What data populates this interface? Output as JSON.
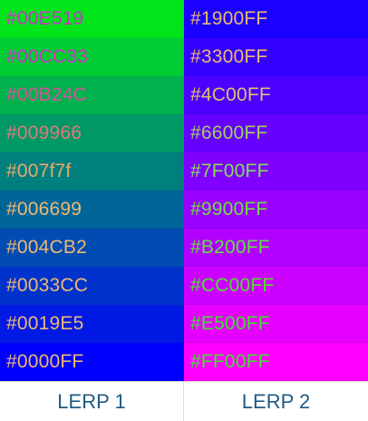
{
  "columns": [
    {
      "label": "LERP 1",
      "cells": [
        {
          "text": "#00E519",
          "bg": "#00E519",
          "fg": "#CC33CC"
        },
        {
          "text": "#00CC33",
          "bg": "#00CC33",
          "fg": "#CC33CC"
        },
        {
          "text": "#00B24C",
          "bg": "#00B24C",
          "fg": "#D84F9E"
        },
        {
          "text": "#009966",
          "bg": "#009966",
          "fg": "#E07880"
        },
        {
          "text": "#007f7f",
          "bg": "#007F7F",
          "fg": "#E9A968"
        },
        {
          "text": "#006699",
          "bg": "#006699",
          "fg": "#F0B870"
        },
        {
          "text": "#004CB2",
          "bg": "#004CB2",
          "fg": "#F0B870"
        },
        {
          "text": "#0033CC",
          "bg": "#0033CC",
          "fg": "#F0B870"
        },
        {
          "text": "#0019E5",
          "bg": "#0019E5",
          "fg": "#F0B870"
        },
        {
          "text": "#0000FF",
          "bg": "#0000FF",
          "fg": "#F0B870"
        }
      ]
    },
    {
      "label": "LERP 2",
      "cells": [
        {
          "text": "#1900FF",
          "bg": "#1900FF",
          "fg": "#F0B870"
        },
        {
          "text": "#3300FF",
          "bg": "#3300FF",
          "fg": "#F0B870"
        },
        {
          "text": "#4C00FF",
          "bg": "#4C00FF",
          "fg": "#E0C070"
        },
        {
          "text": "#6600FF",
          "bg": "#6600FF",
          "fg": "#A0D060"
        },
        {
          "text": "#7F00FF",
          "bg": "#7F00FF",
          "fg": "#80E050"
        },
        {
          "text": "#9900FF",
          "bg": "#9900FF",
          "fg": "#70E040"
        },
        {
          "text": "#B200FF",
          "bg": "#B200FF",
          "fg": "#60E040"
        },
        {
          "text": "#CC00FF",
          "bg": "#CC00FF",
          "fg": "#50E030"
        },
        {
          "text": "#E500FF",
          "bg": "#E500FF",
          "fg": "#40E030"
        },
        {
          "text": "#FF00FF",
          "bg": "#FF00FF",
          "fg": "#40E030"
        }
      ]
    }
  ]
}
